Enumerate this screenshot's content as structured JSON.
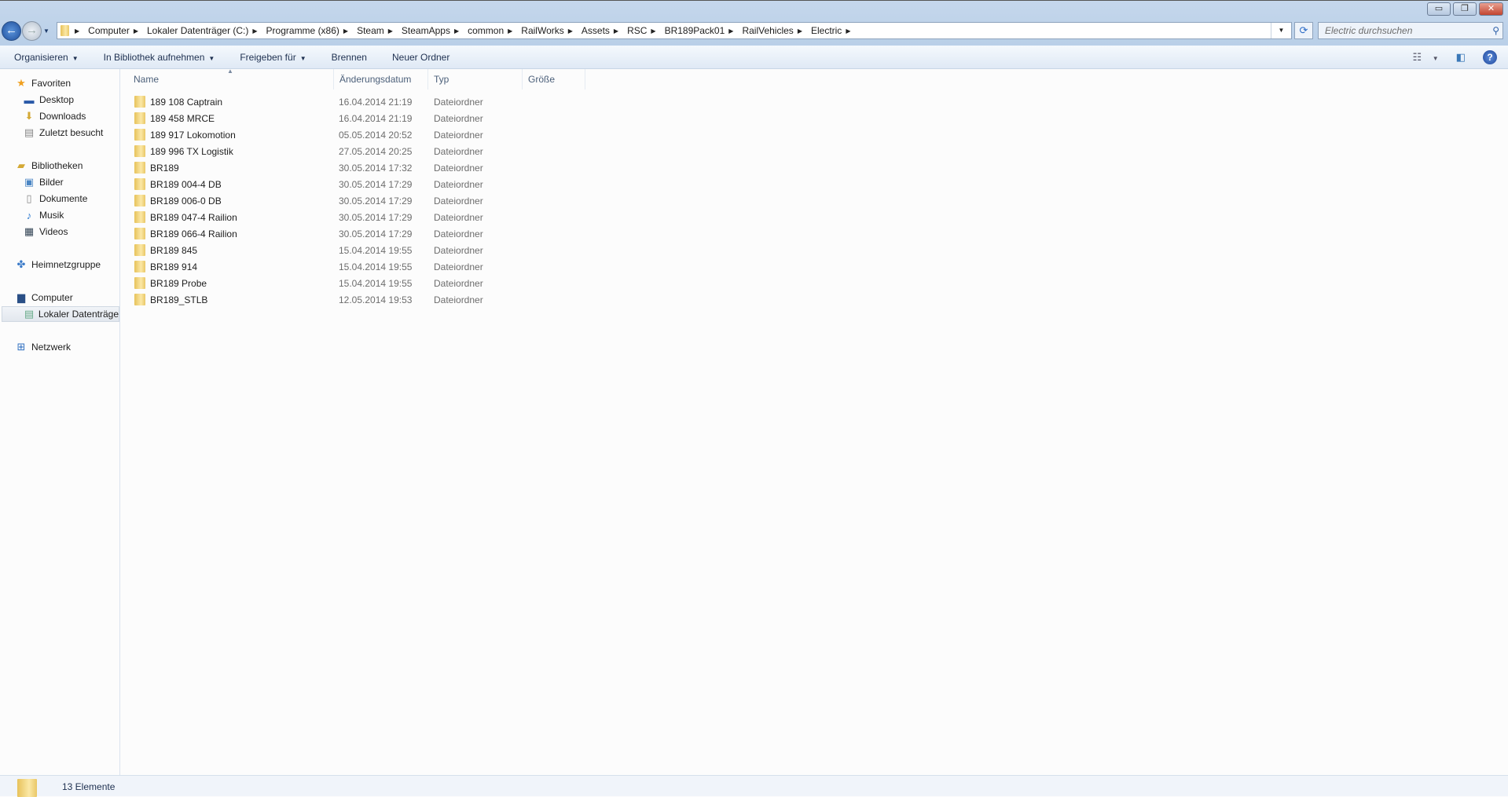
{
  "window": {
    "minimize": "▭",
    "restore": "❐",
    "close": "✕"
  },
  "address": {
    "crumbs": [
      "Computer",
      "Lokaler Datenträger (C:)",
      "Programme (x86)",
      "Steam",
      "SteamApps",
      "common",
      "RailWorks",
      "Assets",
      "RSC",
      "BR189Pack01",
      "RailVehicles",
      "Electric"
    ]
  },
  "search": {
    "placeholder": "Electric durchsuchen"
  },
  "toolbar": {
    "organize": "Organisieren",
    "library": "In Bibliothek aufnehmen",
    "share": "Freigeben für",
    "burn": "Brennen",
    "new_folder": "Neuer Ordner"
  },
  "sidebar": {
    "favorites": "Favoriten",
    "desktop": "Desktop",
    "downloads": "Downloads",
    "recent": "Zuletzt besucht",
    "libraries": "Bibliotheken",
    "pictures": "Bilder",
    "documents": "Dokumente",
    "music": "Musik",
    "videos": "Videos",
    "homegroup": "Heimnetzgruppe",
    "computer": "Computer",
    "local_disk": "Lokaler Datenträge",
    "network": "Netzwerk"
  },
  "columns": {
    "name": "Name",
    "date": "Änderungsdatum",
    "type": "Typ",
    "size": "Größe"
  },
  "files": [
    {
      "name": "189 108 Captrain",
      "date": "16.04.2014 21:19",
      "type": "Dateiordner"
    },
    {
      "name": "189 458 MRCE",
      "date": "16.04.2014 21:19",
      "type": "Dateiordner"
    },
    {
      "name": "189 917 Lokomotion",
      "date": "05.05.2014 20:52",
      "type": "Dateiordner"
    },
    {
      "name": "189 996 TX Logistik",
      "date": "27.05.2014 20:25",
      "type": "Dateiordner"
    },
    {
      "name": "BR189",
      "date": "30.05.2014 17:32",
      "type": "Dateiordner"
    },
    {
      "name": "BR189 004-4 DB",
      "date": "30.05.2014 17:29",
      "type": "Dateiordner"
    },
    {
      "name": "BR189 006-0 DB",
      "date": "30.05.2014 17:29",
      "type": "Dateiordner"
    },
    {
      "name": "BR189 047-4 Railion",
      "date": "30.05.2014 17:29",
      "type": "Dateiordner"
    },
    {
      "name": "BR189 066-4 Railion",
      "date": "30.05.2014 17:29",
      "type": "Dateiordner"
    },
    {
      "name": "BR189 845",
      "date": "15.04.2014 19:55",
      "type": "Dateiordner"
    },
    {
      "name": "BR189 914",
      "date": "15.04.2014 19:55",
      "type": "Dateiordner"
    },
    {
      "name": "BR189 Probe",
      "date": "15.04.2014 19:55",
      "type": "Dateiordner"
    },
    {
      "name": "BR189_STLB",
      "date": "12.05.2014 19:53",
      "type": "Dateiordner"
    }
  ],
  "status": {
    "count": "13 Elemente"
  }
}
